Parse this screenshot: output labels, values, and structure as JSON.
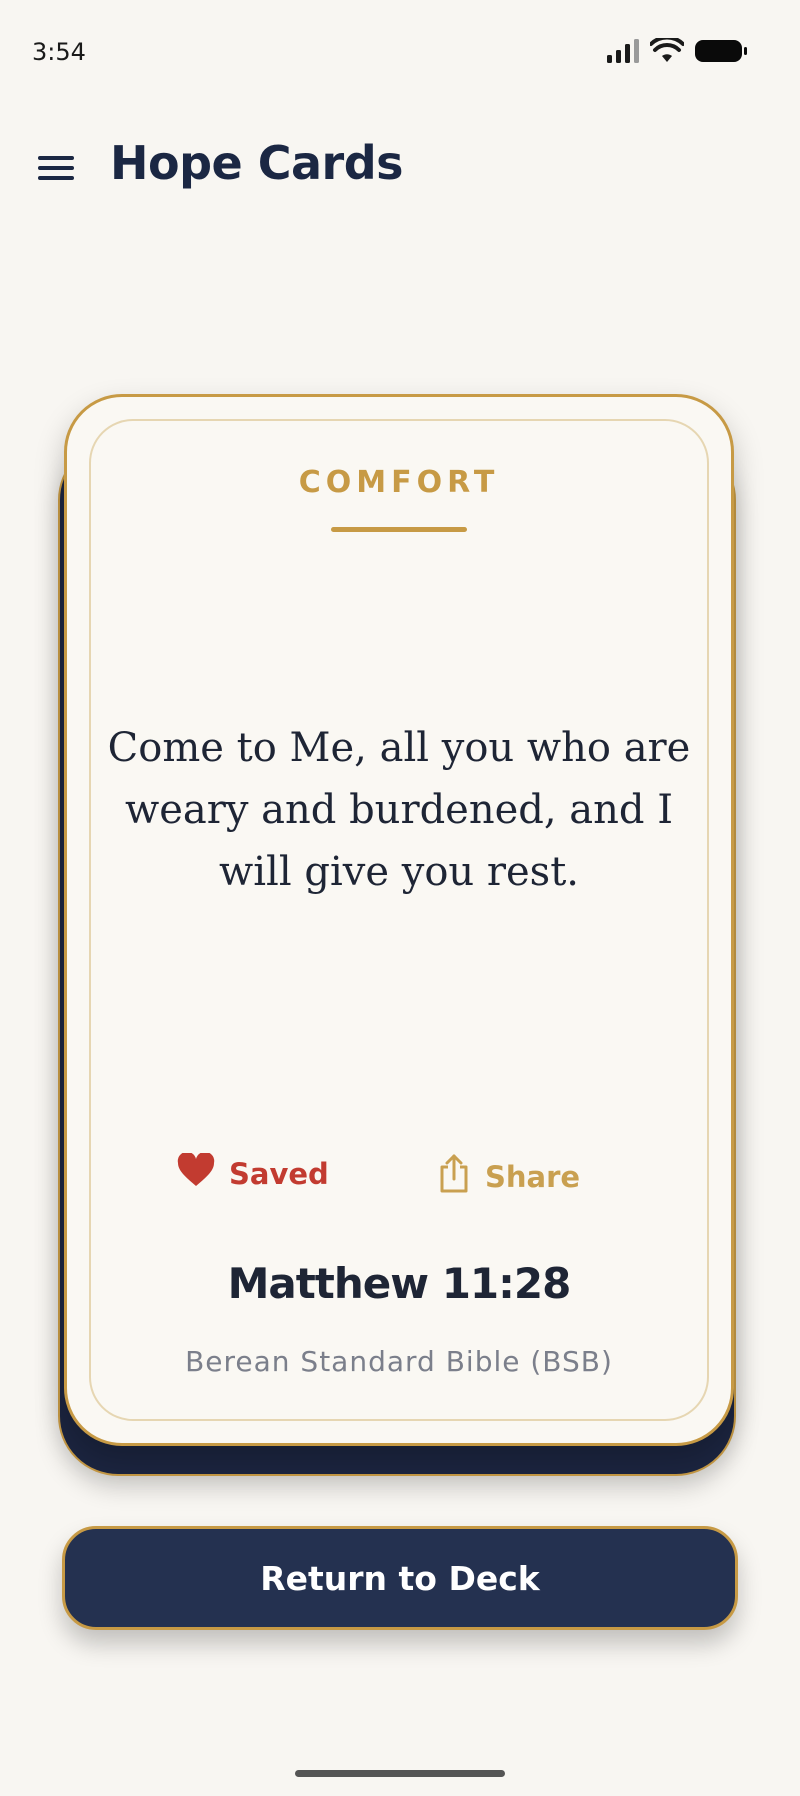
{
  "status_bar": {
    "time": "3:54",
    "icons": [
      "signal-icon",
      "wifi-icon",
      "battery-icon"
    ]
  },
  "header": {
    "menu_icon": "hamburger-menu-icon",
    "title": "Hope Cards"
  },
  "card": {
    "category": "COMFORT",
    "verse": "Come to Me, all you who are weary and burdened, and I will give you rest.",
    "actions": {
      "saved_label": "Saved",
      "saved_icon": "heart-icon",
      "share_label": "Share",
      "share_icon": "share-icon"
    },
    "reference": "Matthew 11:28",
    "translation": "Berean Standard Bible (BSB)"
  },
  "return_button": {
    "label": "Return to Deck"
  },
  "colors": {
    "background": "#f8f6f2",
    "navy": "#1b2743",
    "gold": "#c79a45",
    "saved_red": "#c23b30",
    "button_navy": "#243150"
  }
}
